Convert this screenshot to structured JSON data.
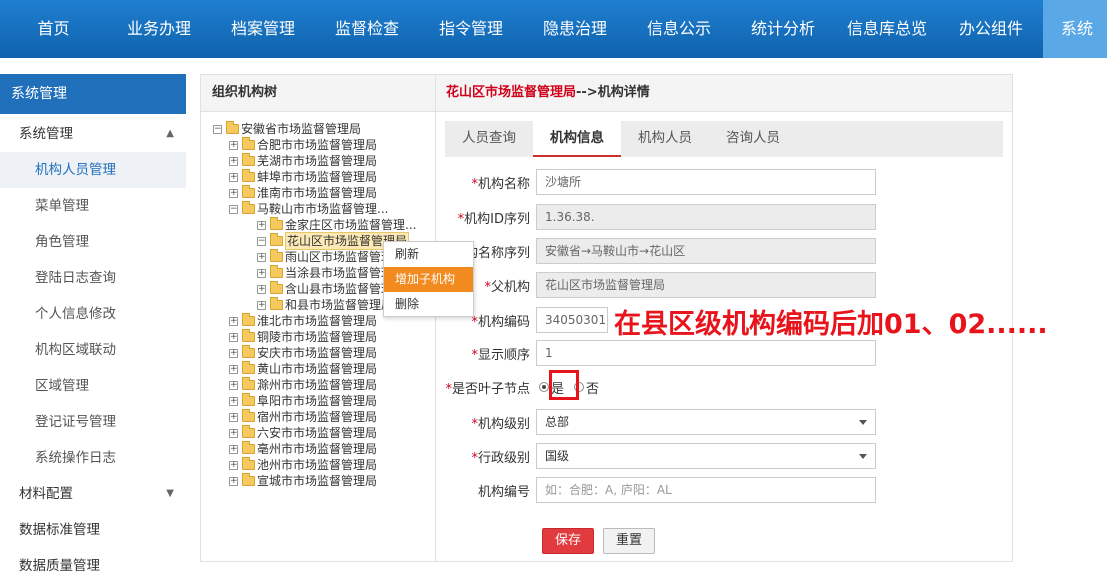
{
  "topnav": {
    "items": [
      "首页",
      "业务办理",
      "档案管理",
      "监督检查",
      "指令管理",
      "隐患治理",
      "信息公示",
      "统计分析",
      "信息库总览",
      "办公组件",
      "系统管"
    ]
  },
  "sidebar": {
    "header": "系统管理",
    "group1": "系统管理",
    "items": [
      "机构人员管理",
      "菜单管理",
      "角色管理",
      "登陆日志查询",
      "个人信息修改",
      "机构区域联动",
      "区域管理",
      "登记证号管理",
      "系统操作日志"
    ],
    "group2": "材料配置",
    "group3": "数据标准管理",
    "group4": "数据质量管理"
  },
  "tree": {
    "title": "组织机构树",
    "root": "安徽省市场监督管理局",
    "nodes": [
      "合肥市市场监督管理局",
      "芜湖市市场监督管理局",
      "蚌埠市市场监督管理局",
      "淮南市市场监督管理局",
      "马鞍山市市场监督管理..."
    ],
    "children": [
      "金家庄区市场监督管理...",
      "花山区市场监督管理局",
      "雨山区市场监督管理局",
      "当涂县市场监督管理局",
      "含山县市场监督管理局",
      "和县市场监督管理局"
    ],
    "rest": [
      "淮北市市场监督管理局",
      "铜陵市市场监督管理局",
      "安庆市市场监督管理局",
      "黄山市市场监督管理局",
      "滁州市市场监督管理局",
      "阜阳市市场监督管理局",
      "宿州市市场监督管理局",
      "六安市市场监督管理局",
      "亳州市市场监督管理局",
      "池州市市场监督管理局",
      "宣城市市场监督管理局"
    ]
  },
  "context_menu": {
    "items": [
      "刷新",
      "增加子机构",
      "删除"
    ]
  },
  "detail": {
    "crumb_org": "花山区市场监督管理局",
    "crumb_rest": "-->机构详情",
    "tabs": [
      "人员查询",
      "机构信息",
      "机构人员",
      "咨询人员"
    ],
    "fields": {
      "name_label": "机构名称",
      "name_value": "沙塘所",
      "id_label": "机构ID序列",
      "id_value": "1.36.38.",
      "seq_label": "机构名称序列",
      "seq_value": "安徽省→马鞍山市→花山区",
      "parent_label": "父机构",
      "parent_value": "花山区市场监督管理局",
      "code_label": "机构编码",
      "code_value": "34050301",
      "order_label": "显示顺序",
      "order_value": "1",
      "leaf_label": "是否叶子节点",
      "leaf_yes": "是",
      "leaf_no": "否",
      "level_label": "机构级别",
      "level_value": "总部",
      "admin_label": "行政级别",
      "admin_value": "国级",
      "num_label": "机构编号",
      "num_placeholder": "如：合肥：A, 庐阳：AL"
    },
    "save": "保存",
    "reset": "重置"
  },
  "annotation": "在县区级机构编码后加01、02......"
}
